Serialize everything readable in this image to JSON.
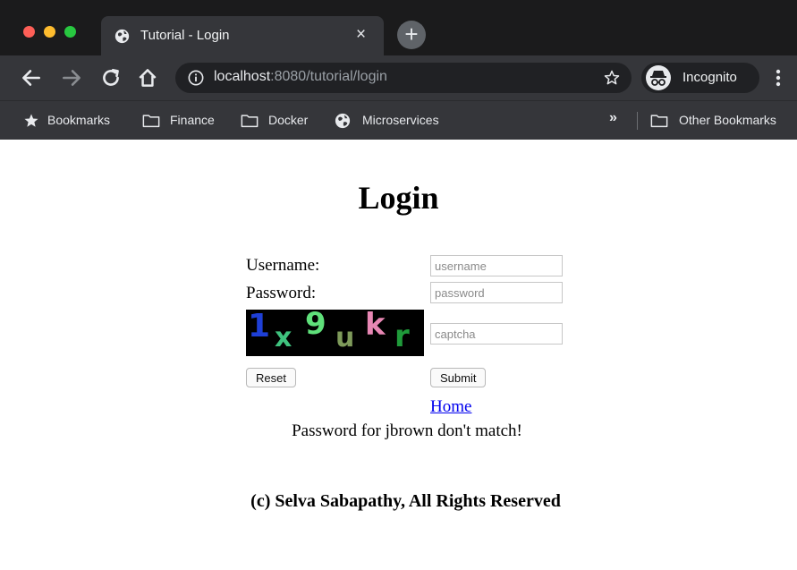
{
  "browser": {
    "tab": {
      "title": "Tutorial - Login",
      "close_label": "×"
    },
    "new_tab_label": "+",
    "address": {
      "host": "localhost",
      "path": ":8080/tutorial/login"
    },
    "profile_label": "Incognito",
    "bookmarks": [
      {
        "label": "Bookmarks",
        "icon": "star-icon"
      },
      {
        "label": "Finance",
        "icon": "folder-icon"
      },
      {
        "label": "Docker",
        "icon": "folder-icon"
      },
      {
        "label": "Microservices",
        "icon": "globe-icon"
      }
    ],
    "overflow_label": "»",
    "other_bookmarks": "Other Bookmarks"
  },
  "page": {
    "heading": "Login",
    "username_label": "Username:",
    "password_label": "Password:",
    "username_placeholder": "username",
    "password_placeholder": "password",
    "captcha_placeholder": "captcha",
    "captcha_chars": [
      {
        "ch": "1",
        "color": "#1e3fd6"
      },
      {
        "ch": "x",
        "color": "#3fc27e"
      },
      {
        "ch": "9",
        "color": "#5fe07a"
      },
      {
        "ch": "u",
        "color": "#7e9a5a"
      },
      {
        "ch": "k",
        "color": "#e887b4"
      },
      {
        "ch": "r",
        "color": "#1f9a3a"
      }
    ],
    "reset_label": "Reset",
    "submit_label": "Submit",
    "home_link": "Home",
    "error_message": "Password for jbrown don't match!",
    "footer": "(c) Selva Sabapathy, All Rights Reserved"
  }
}
